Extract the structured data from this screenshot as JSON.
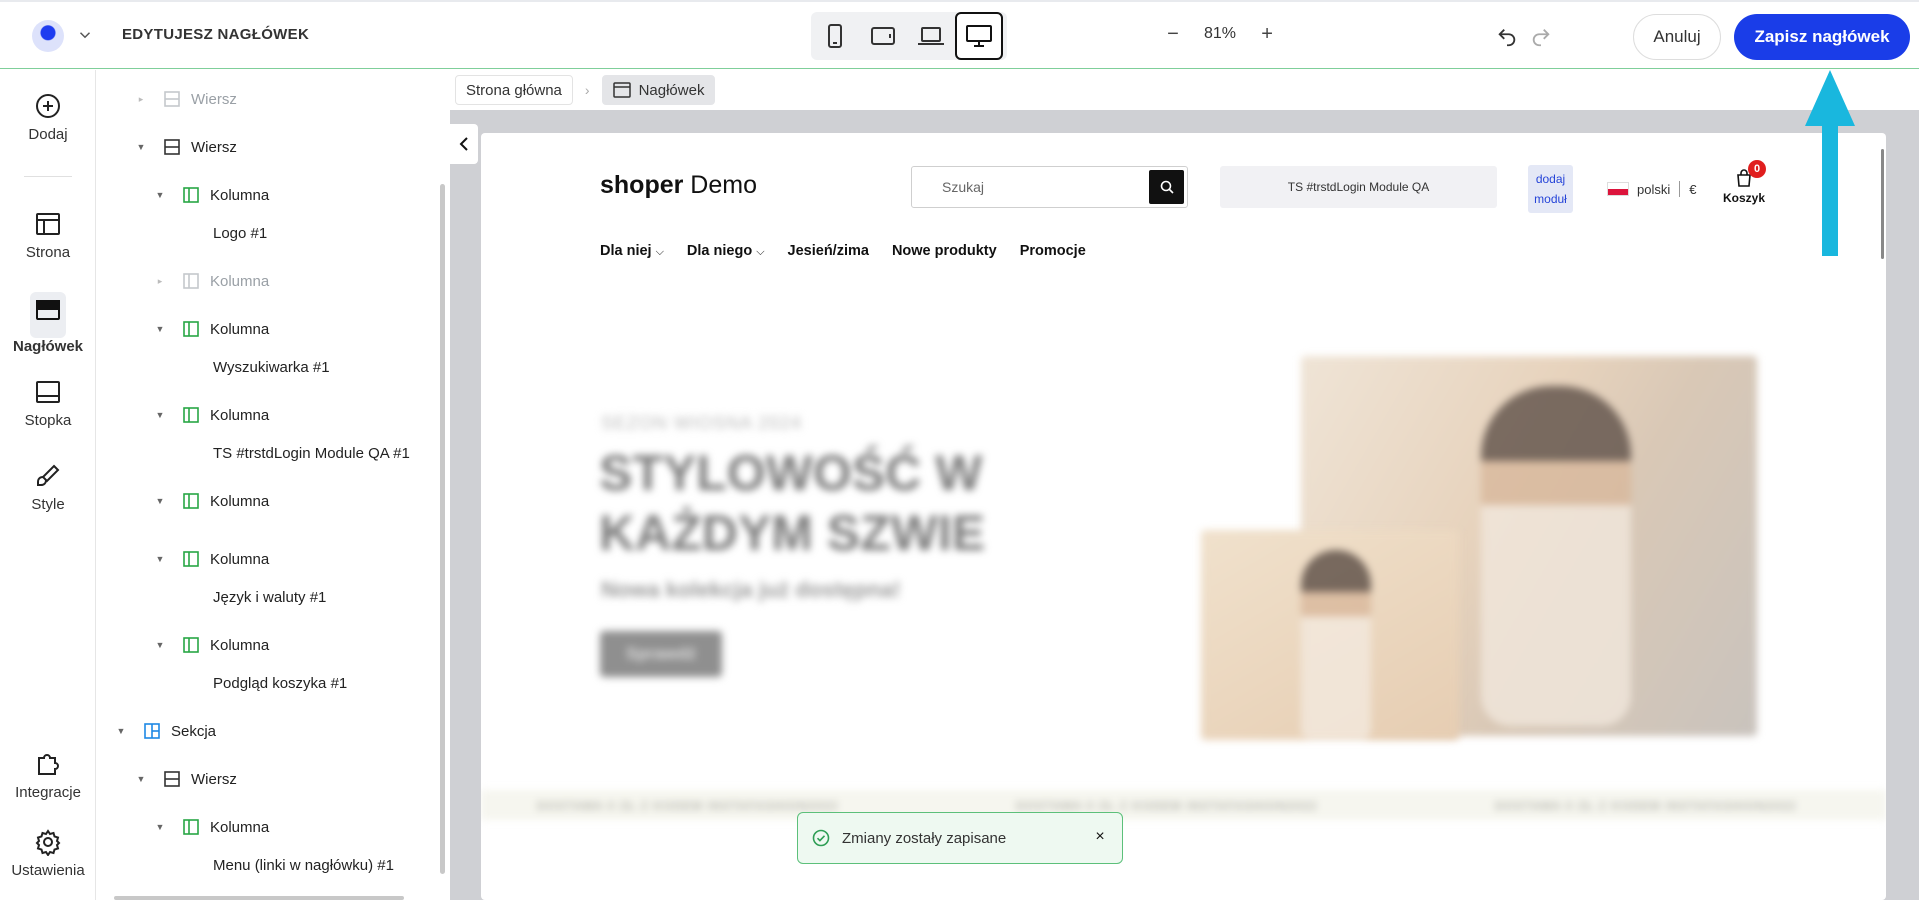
{
  "topbar": {
    "editing_title": "EDYTUJESZ NAGŁÓWEK",
    "devices": [
      "mobile-portrait",
      "tablet-landscape",
      "laptop",
      "desktop"
    ],
    "active_device": "desktop",
    "zoom": "81%",
    "zoom_minus": "−",
    "zoom_plus": "+",
    "cancel_label": "Anuluj",
    "save_label": "Zapisz nagłówek"
  },
  "rail": {
    "items": [
      {
        "label": "Dodaj",
        "icon": "plus-circle-icon"
      },
      {
        "label": "Strona",
        "icon": "layout-icon"
      },
      {
        "label": "Nagłówek",
        "icon": "header-icon"
      },
      {
        "label": "Stopka",
        "icon": "footer-icon"
      },
      {
        "label": "Style",
        "icon": "brush-icon"
      },
      {
        "label": "Integracje",
        "icon": "puzzle-icon"
      },
      {
        "label": "Ustawienia",
        "icon": "gear-icon"
      }
    ],
    "active": "Nagłówek"
  },
  "tree": {
    "rows": [
      {
        "label": "Wiersz",
        "kind": "row",
        "dim": true
      },
      {
        "label": "Wiersz",
        "kind": "row"
      },
      {
        "label": "Kolumna",
        "kind": "column"
      },
      {
        "label": "Logo #1",
        "kind": "module"
      },
      {
        "label": "Kolumna",
        "kind": "column",
        "dim": true
      },
      {
        "label": "Kolumna",
        "kind": "column"
      },
      {
        "label": "Wyszukiwarka #1",
        "kind": "module"
      },
      {
        "label": "Kolumna",
        "kind": "column"
      },
      {
        "label": "TS #trstdLogin Module QA #1",
        "kind": "module"
      },
      {
        "label": "Kolumna",
        "kind": "column"
      },
      {
        "label": "Kolumna",
        "kind": "column"
      },
      {
        "label": "Język i waluty #1",
        "kind": "module"
      },
      {
        "label": "Kolumna",
        "kind": "column"
      },
      {
        "label": "Podgląd koszyka #1",
        "kind": "module"
      },
      {
        "label": "Sekcja",
        "kind": "section"
      },
      {
        "label": "Wiersz",
        "kind": "row"
      },
      {
        "label": "Kolumna",
        "kind": "column"
      },
      {
        "label": "Menu (linki w nagłówku) #1",
        "kind": "module"
      }
    ]
  },
  "breadcrumb": {
    "home": "Strona główna",
    "separator": "›",
    "current": "Nagłówek"
  },
  "preview": {
    "logo_bold": "shoper",
    "logo_rest": " Demo",
    "search_placeholder": "Szukaj",
    "module_label": "TS #trstdLogin Module QA",
    "add_module_line1": "dodaj",
    "add_module_line2": "moduł",
    "language": "polski",
    "currency": "€",
    "cart_label": "Koszyk",
    "cart_count": "0",
    "nav": [
      "Dla niej",
      "Dla niego",
      "Jesień/zima",
      "Nowe produkty",
      "Promocje"
    ],
    "hero": {
      "season": "SEZON WIOSNA 2024",
      "title_line1": "STYLOWOŚĆ W",
      "title_line2": "KAŻDYM SZWIE",
      "subtitle": "Nowa kolekcja już dostępna!",
      "button": "Sprawdź"
    },
    "promo_text": "DOSTAWA 0 ZŁ Z KODEM INSTAFASHION2022"
  },
  "toast": {
    "message": "Zmiany zostały zapisane",
    "close": "×"
  },
  "colors": {
    "primary": "#1a3de8",
    "success": "#5cc07a",
    "annotation_arrow": "#19b7de",
    "column_icon": "#28a745",
    "section_icon": "#1e88e5"
  }
}
